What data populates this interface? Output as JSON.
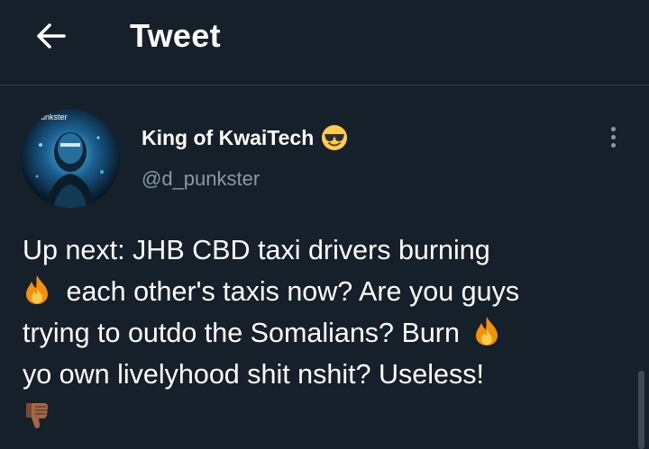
{
  "header": {
    "title": "Tweet",
    "back_icon": "arrow-left-icon"
  },
  "author": {
    "display_name": "King of KwaiTech",
    "name_emoji": "smiling-face-with-sunglasses-icon",
    "handle": "@d_punkster",
    "avatar_overlay_text": "unkster"
  },
  "tweet": {
    "segments": [
      "Up next: JHB CBD taxi drivers burning",
      "each other's taxis now? Are you guys",
      "trying to outdo the Somalians? Burn",
      "yo own livelyhood shit nshit? Useless!"
    ],
    "emoji_fire": "fire-icon",
    "emoji_thumb": "thumbs-down-icon"
  },
  "colors": {
    "background": "#15202b",
    "text_primary": "#ffffff",
    "text_secondary": "#8899a6",
    "divider": "#38444d"
  }
}
